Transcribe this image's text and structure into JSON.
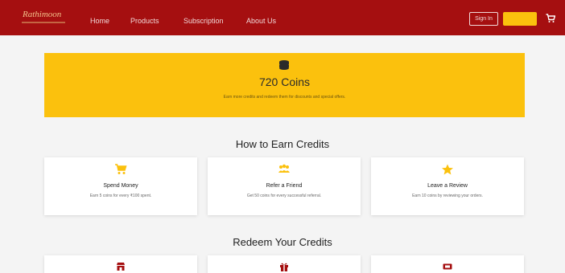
{
  "colors": {
    "nav": "#a50f10",
    "accent": "#fbc10d",
    "background": "#f4f4f4"
  },
  "navbar": {
    "logo": "Rathimoon",
    "links": [
      "Home",
      "Products",
      "Subscription",
      "About Us"
    ],
    "signin_label": "Sign In",
    "cta_label": "",
    "cart_icon": "cart-icon"
  },
  "banner": {
    "icon": "coins-icon",
    "coins": "720 Coins",
    "description": "Earn more credits and redeem them for discounts and special offers."
  },
  "earn": {
    "title": "How to Earn Credits",
    "cards": [
      {
        "icon": "cart-icon",
        "title": "Spend Money",
        "desc": "Earn 5 coins for every ₹100 spent."
      },
      {
        "icon": "users-icon",
        "title": "Refer a Friend",
        "desc": "Get 50 coins for every successful referral."
      },
      {
        "icon": "star-icon",
        "title": "Leave a Review",
        "desc": "Earn 10 coins by reviewing your orders."
      }
    ]
  },
  "redeem": {
    "title": "Redeem Your Credits",
    "cards": [
      {
        "icon": "store-icon"
      },
      {
        "icon": "gift-icon"
      },
      {
        "icon": "ticket-icon"
      }
    ]
  }
}
